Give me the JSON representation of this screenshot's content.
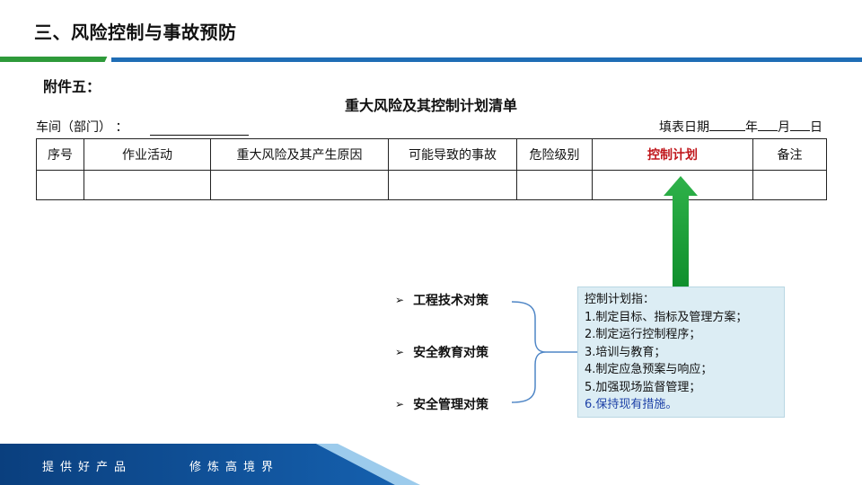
{
  "header": {
    "title": "三、风险控制与事故预防"
  },
  "document": {
    "attachment": "附件五：",
    "title": "重大风险及其控制计划清单",
    "workshop_label": "车间（部门）   ：",
    "date": {
      "label": "填表日期",
      "year": "年",
      "month": "月",
      "day": "日"
    },
    "table": {
      "columns": [
        "序号",
        "作业活动",
        "重大风险及其产生原因",
        "可能导致的事故",
        "危险级别",
        "控制计划",
        "备注"
      ],
      "rows": [
        [
          "",
          "",
          "",
          "",
          "",
          "",
          ""
        ]
      ]
    }
  },
  "measures": {
    "items": [
      "工程技术对策",
      "安全教育对策",
      "安全管理对策"
    ]
  },
  "control_plan": {
    "heading": "控制计划指：",
    "items": [
      "1.制定目标、指标及管理方案；",
      "2.制定运行控制程序；",
      "3.培训与教育；",
      "4.制定应急预案与响应；",
      "5.加强现场监督管理；",
      "6.保持现有措施。"
    ]
  },
  "footer": {
    "slogan_left": "提供好产品",
    "slogan_right": "修炼高境界"
  },
  "colors": {
    "accent_red": "#c0161b",
    "accent_green": "#2e9a3a",
    "brand_blue": "#1f6db5",
    "footer_blue": "#0b4a8f",
    "info_bg": "#dcedf4",
    "info_highlight": "#1f43a8"
  }
}
